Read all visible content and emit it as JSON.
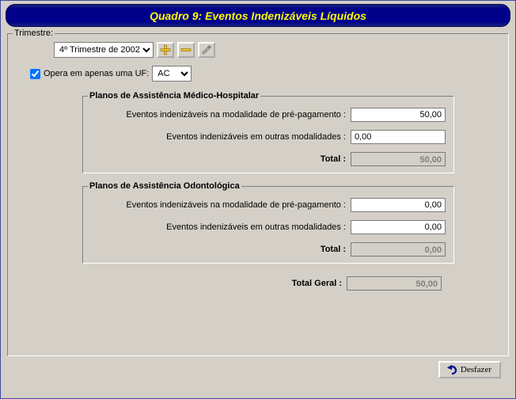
{
  "title": "Quadro 9: Eventos Indenizáveis Líquidos",
  "top": {
    "trimestre_label": "Trimestre:",
    "trimestre_value": "4º Trimestre de 2002",
    "opera_uf_label": "Opera em apenas uma UF:",
    "opera_uf_checked": true,
    "uf_value": "AC"
  },
  "group1": {
    "legend": "Planos de Assistência Médico-Hospitalar",
    "row1_label": "Eventos indenizáveis na modalidade de pré-pagamento :",
    "row1_value": "50,00",
    "row2_label": "Eventos indenizáveis em outras modalidades :",
    "row2_value": "0,00",
    "total_label": "Total :",
    "total_value": "50,00"
  },
  "group2": {
    "legend": "Planos de Assistência Odontológica",
    "row1_label": "Eventos indenizáveis na modalidade de pré-pagamento :",
    "row1_value": "0,00",
    "row2_label": "Eventos indenizáveis em outras modalidades :",
    "row2_value": "0,00",
    "total_label": "Total :",
    "total_value": "0,00"
  },
  "grand_total_label": "Total Geral :",
  "grand_total_value": "50,00",
  "undo_label": "Desfazer"
}
